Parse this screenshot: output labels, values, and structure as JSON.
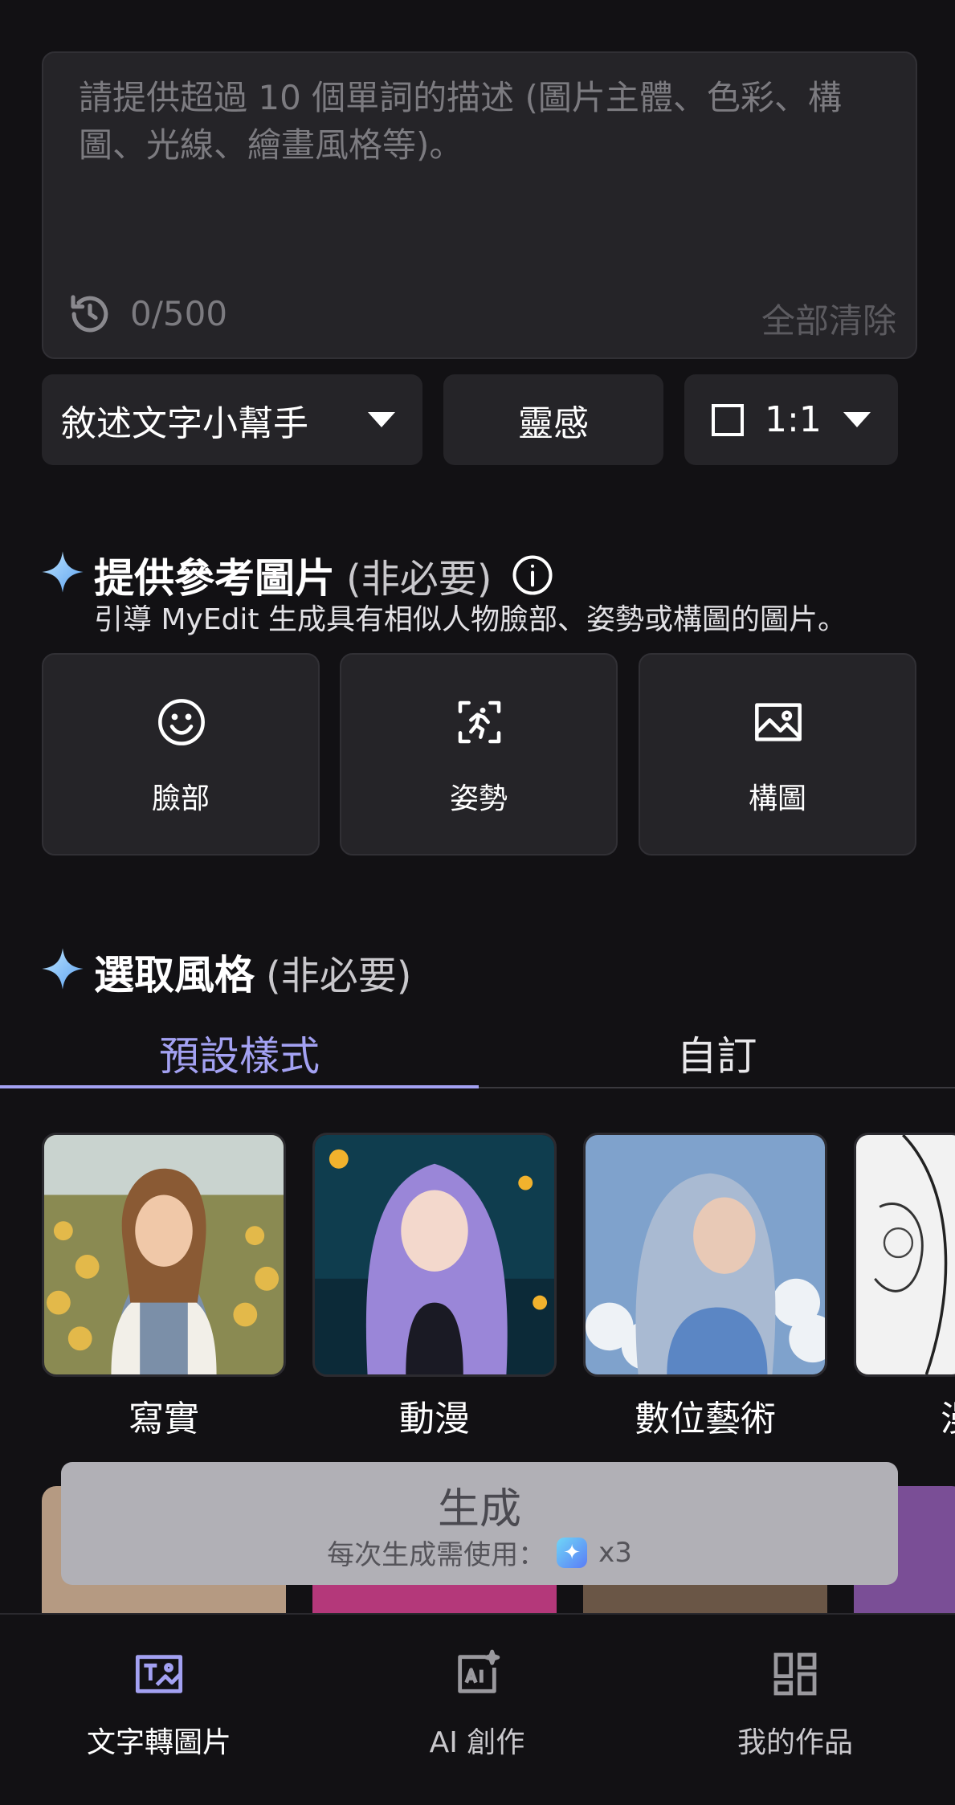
{
  "prompt": {
    "placeholder": "請提供超過 10 個單詞的描述 (圖片主體、色彩、構圖、光線、繪畫風格等)。",
    "counter": "0/500",
    "clear_label": "全部清除"
  },
  "options": {
    "helper_label": "敘述文字小幫手",
    "inspiration_label": "靈感",
    "ratio_label": "1:1"
  },
  "reference": {
    "title": "提供參考圖片",
    "optional": "(非必要)",
    "subtitle": "引導 MyEdit 生成具有相似人物臉部、姿勢或構圖的圖片。",
    "cards": [
      {
        "label": "臉部",
        "icon": "face-icon"
      },
      {
        "label": "姿勢",
        "icon": "pose-icon"
      },
      {
        "label": "構圖",
        "icon": "composition-icon"
      }
    ]
  },
  "style": {
    "title": "選取風格",
    "optional": "(非必要)",
    "tabs": [
      {
        "label": "預設樣式",
        "active": true
      },
      {
        "label": "自訂",
        "active": false
      }
    ],
    "items": [
      {
        "label": "寫實"
      },
      {
        "label": "動漫"
      },
      {
        "label": "數位藝術"
      },
      {
        "label": "漫"
      }
    ]
  },
  "generate": {
    "label": "生成",
    "cost_prefix": "每次生成需使用：",
    "cost_value": "x3"
  },
  "nav": {
    "items": [
      {
        "label": "文字轉圖片",
        "active": true,
        "icon": "text-to-image-icon"
      },
      {
        "label": "AI 創作",
        "active": false,
        "icon": "ai-create-icon"
      },
      {
        "label": "我的作品",
        "active": false,
        "icon": "my-works-icon"
      }
    ]
  },
  "colors": {
    "accent": "#a3a1f2",
    "background": "#121114",
    "card": "#252428"
  }
}
